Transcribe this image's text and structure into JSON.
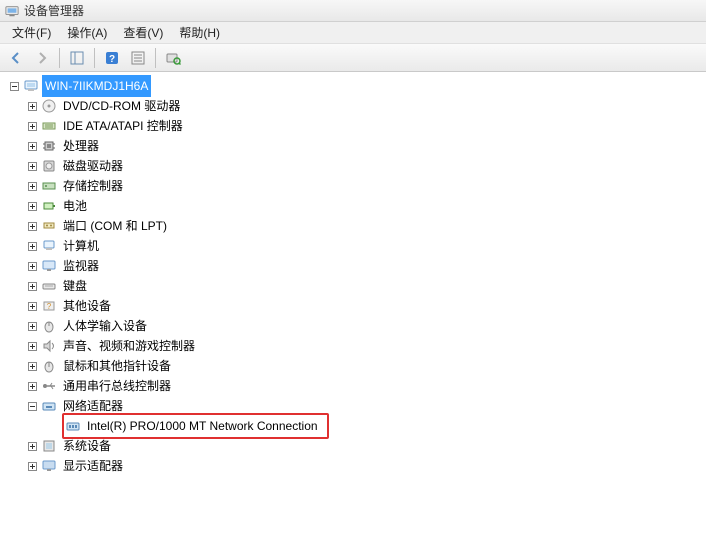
{
  "window": {
    "title": "设备管理器"
  },
  "menubar": {
    "file": "文件(F)",
    "action": "操作(A)",
    "view": "查看(V)",
    "help": "帮助(H)"
  },
  "tree": {
    "root": "WIN-7IIKMDJ1H6A",
    "nodes": [
      {
        "id": "dvd",
        "label": "DVD/CD-ROM 驱动器",
        "expanded": false
      },
      {
        "id": "ide",
        "label": "IDE ATA/ATAPI 控制器",
        "expanded": false
      },
      {
        "id": "cpu",
        "label": "处理器",
        "expanded": false
      },
      {
        "id": "disk",
        "label": "磁盘驱动器",
        "expanded": false
      },
      {
        "id": "storage",
        "label": "存储控制器",
        "expanded": false
      },
      {
        "id": "battery",
        "label": "电池",
        "expanded": false
      },
      {
        "id": "ports",
        "label": "端口 (COM 和 LPT)",
        "expanded": false
      },
      {
        "id": "computer",
        "label": "计算机",
        "expanded": false
      },
      {
        "id": "monitor",
        "label": "监视器",
        "expanded": false
      },
      {
        "id": "keyboard",
        "label": "键盘",
        "expanded": false
      },
      {
        "id": "other",
        "label": "其他设备",
        "expanded": false
      },
      {
        "id": "hid",
        "label": "人体学输入设备",
        "expanded": false
      },
      {
        "id": "sound",
        "label": "声音、视频和游戏控制器",
        "expanded": false
      },
      {
        "id": "mouse",
        "label": "鼠标和其他指针设备",
        "expanded": false
      },
      {
        "id": "usb",
        "label": "通用串行总线控制器",
        "expanded": false
      },
      {
        "id": "network",
        "label": "网络适配器",
        "expanded": true,
        "children": [
          {
            "id": "nic1",
            "label": "Intel(R) PRO/1000 MT Network Connection",
            "highlighted": true
          }
        ]
      },
      {
        "id": "system",
        "label": "系统设备",
        "expanded": false
      },
      {
        "id": "display",
        "label": "显示适配器",
        "expanded": false
      }
    ]
  }
}
